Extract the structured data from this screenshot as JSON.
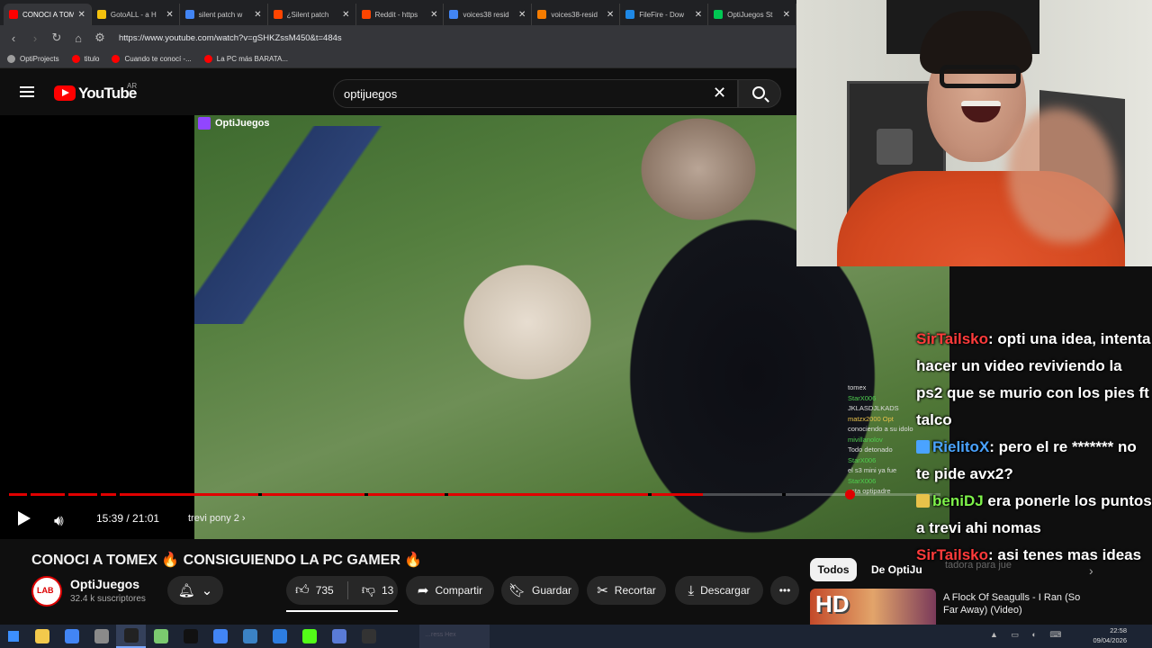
{
  "browser": {
    "tabs": [
      {
        "label": "CONOCI A TOM",
        "color": "#ff0000",
        "active": true
      },
      {
        "label": "GotoALL - a H",
        "color": "#f4c20d",
        "active": false
      },
      {
        "label": "silent patch w",
        "color": "#4285f4",
        "active": false
      },
      {
        "label": "¿Silent patch",
        "color": "#ff4500",
        "active": false
      },
      {
        "label": "Reddit - https",
        "color": "#ff4500",
        "active": false
      },
      {
        "label": "voices38 resid",
        "color": "#4285f4",
        "active": false
      },
      {
        "label": "voices38-resid",
        "color": "#f57c00",
        "active": false
      },
      {
        "label": "FileFire - Dow",
        "color": "#1e88e5",
        "active": false
      },
      {
        "label": "OptiJuegos St",
        "color": "#00c853",
        "active": false
      }
    ],
    "tab_close": "✕",
    "url": "https://www.youtube.com/watch?v=gSHKZssM450&t=484s",
    "bookmarks": [
      {
        "label": "OptiProjects",
        "color": "#9e9e9e"
      },
      {
        "label": "titulo",
        "color": "#ff0000"
      },
      {
        "label": "Cuando te conocí -...",
        "color": "#ff0000"
      },
      {
        "label": "La PC más BARATA...",
        "color": "#ff0000"
      }
    ]
  },
  "youtube": {
    "logo_text": "YouTube",
    "country": "AR",
    "search_value": "optijuegos",
    "clear_icon": "close-icon",
    "search_icon": "search-icon"
  },
  "player": {
    "stream_label": "OptiJuegos",
    "time": "15:39 / 21:01",
    "chapter": "trevi pony 2 ›",
    "progress_fraction": 0.745,
    "mini_chat": [
      {
        "text": "tomex",
        "cls": ""
      },
      {
        "text": "StarX006",
        "cls": "g"
      },
      {
        "text": "JKLASDJLKADS",
        "cls": ""
      },
      {
        "text": "matzx2000 Opt",
        "cls": "y"
      },
      {
        "text": "conociendo a su idolo",
        "cls": ""
      },
      {
        "text": "mivillanolov",
        "cls": "g"
      },
      {
        "text": "Todo detonado",
        "cls": ""
      },
      {
        "text": "StarX006",
        "cls": "g"
      },
      {
        "text": "el s3 mini ya fue",
        "cls": ""
      },
      {
        "text": "StarX006",
        "cls": "g"
      },
      {
        "text": "esta optipadre",
        "cls": ""
      }
    ]
  },
  "chat": [
    {
      "user": "SirTailsko",
      "ucls": "u-red",
      "msg": ": opti una idea, intenta hacer un video reviviendo la ps2 que se murio con los pies ft talco",
      "badge": ""
    },
    {
      "user": "RielitoX",
      "ucls": "u-blue",
      "msg": ": pero el re ******* no te pide avx2?",
      "badge": "#4aa3ff"
    },
    {
      "user": "beniDJ",
      "ucls": "u-green",
      "msg": " era ponerle los puntos a trevi ahi nomas",
      "badge": "#e8c24a"
    },
    {
      "user": "SirTailsko",
      "ucls": "u-red",
      "msg": ": asi tenes mas ideas",
      "badge": ""
    }
  ],
  "video": {
    "title": "CONOCI A TOMEX 🔥 CONSIGUIENDO LA PC GAMER 🔥",
    "channel": "OptiJuegos",
    "subscribers": "32.4 k suscriptores",
    "likes": "735",
    "dislikes": "13",
    "share": "Compartir",
    "save": "Guardar",
    "clip": "Recortar",
    "download": "Descargar",
    "more": "•••"
  },
  "sidebar": {
    "chip_all": "Todos",
    "chip_from": "De OptiJu",
    "chip_gamer": "tadora para jue",
    "rec_badge": "HD",
    "rec_title_1": "A Flock Of Seagulls - I Ran (So",
    "rec_title_2": "Far Away) (Video)"
  },
  "taskbar": {
    "search_hint": "…ress    Hex",
    "apps": [
      {
        "name": "file-explorer-icon",
        "color": "#f2c94c",
        "active": false
      },
      {
        "name": "chrome-icon",
        "color": "#4285f4",
        "active": false
      },
      {
        "name": "app-icon",
        "color": "#8a8a8a",
        "active": false
      },
      {
        "name": "obs-icon",
        "color": "#222222",
        "active": true
      },
      {
        "name": "notepad-icon",
        "color": "#7bc96f",
        "active": false
      },
      {
        "name": "terminal-icon",
        "color": "#111111",
        "active": false
      },
      {
        "name": "chrome-icon-2",
        "color": "#4285f4",
        "active": false
      },
      {
        "name": "vscode-folder-icon",
        "color": "#3b82c4",
        "active": false
      },
      {
        "name": "vscode-icon",
        "color": "#2d7de0",
        "active": false
      },
      {
        "name": "kick-icon",
        "color": "#53fc18",
        "active": false
      },
      {
        "name": "monitor-icon",
        "color": "#5a7bd6",
        "active": false
      },
      {
        "name": "calc-icon",
        "color": "#333333",
        "active": false
      }
    ],
    "time": "22:58",
    "date": "09/04/2026"
  }
}
